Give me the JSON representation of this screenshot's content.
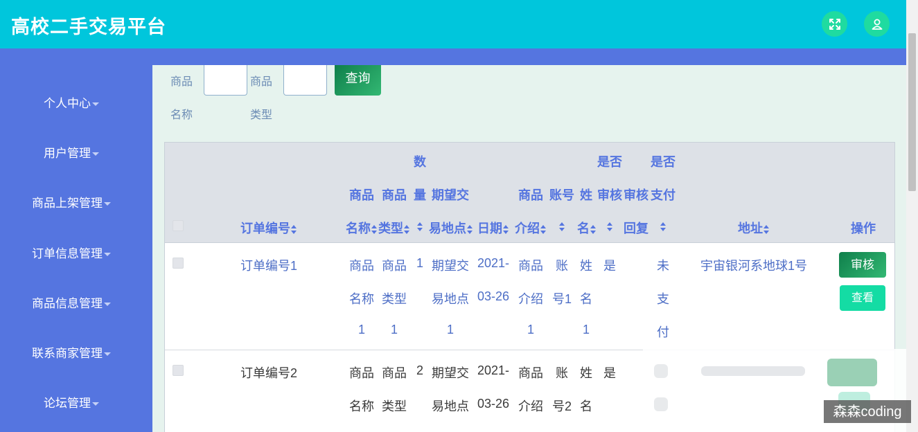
{
  "header": {
    "title": "高校二手交易平台",
    "fullscreen_icon": "fullscreen-icon",
    "user_icon": "user-icon"
  },
  "sidebar": {
    "items": [
      {
        "label": "个人中心"
      },
      {
        "label": "用户管理"
      },
      {
        "label": "商品上架管理"
      },
      {
        "label": "订单信息管理"
      },
      {
        "label": "商品信息管理"
      },
      {
        "label": "联系商家管理"
      },
      {
        "label": "论坛管理"
      }
    ]
  },
  "search": {
    "name_label": [
      "商品",
      "名称"
    ],
    "type_label": [
      "商品",
      "类型"
    ],
    "name_value": "",
    "type_value": "",
    "query_label": "查询"
  },
  "table": {
    "headers": {
      "order_no": "订单编号",
      "goods_name": [
        "商品",
        "名称"
      ],
      "goods_type": [
        "商品",
        "类型"
      ],
      "qty": [
        "数",
        "量"
      ],
      "place": [
        "期望交",
        "易地点"
      ],
      "date": "日期",
      "intro": [
        "商品",
        "介绍"
      ],
      "account": "账号",
      "name": [
        "姓",
        "名"
      ],
      "audit": [
        "是否",
        "审核"
      ],
      "reply": [
        "审核",
        "回复"
      ],
      "paid": [
        "是否",
        "支付"
      ],
      "address": "地址",
      "action": "操作"
    },
    "rows": [
      {
        "order_no": "订单编号1",
        "goods_name": [
          "商品",
          "名称",
          "1"
        ],
        "goods_type": [
          "商品",
          "类型",
          "1"
        ],
        "qty": "1",
        "place": [
          "期望交",
          "易地点",
          "1"
        ],
        "date": [
          "2021-",
          "03-26"
        ],
        "intro": [
          "商品",
          "介绍",
          "1"
        ],
        "account": [
          "账",
          "号1"
        ],
        "name": [
          "姓",
          "名",
          "1"
        ],
        "audit": "是",
        "paid": [
          "未",
          "支",
          "付"
        ],
        "address": "宇宙银河系地球1号",
        "audit_btn": "审核",
        "view_btn": "查看"
      },
      {
        "order_no": "订单编号2",
        "goods_name": [
          "商品",
          "名称"
        ],
        "goods_type": [
          "商品",
          "类型"
        ],
        "qty": "2",
        "place": [
          "期望交",
          "易地点"
        ],
        "date": [
          "2021-",
          "03-26"
        ],
        "intro": [
          "商品",
          "介绍"
        ],
        "account": [
          "账",
          "号2"
        ],
        "name": [
          "姓",
          "名"
        ],
        "audit": "是"
      }
    ]
  },
  "watermark": "森森coding",
  "colors": {
    "topbar": "#00c6dc",
    "sidebar": "#5575e0",
    "content_bg": "#e6f3ee",
    "audit_button": "#1a8f57",
    "view_button": "#14dca4"
  }
}
